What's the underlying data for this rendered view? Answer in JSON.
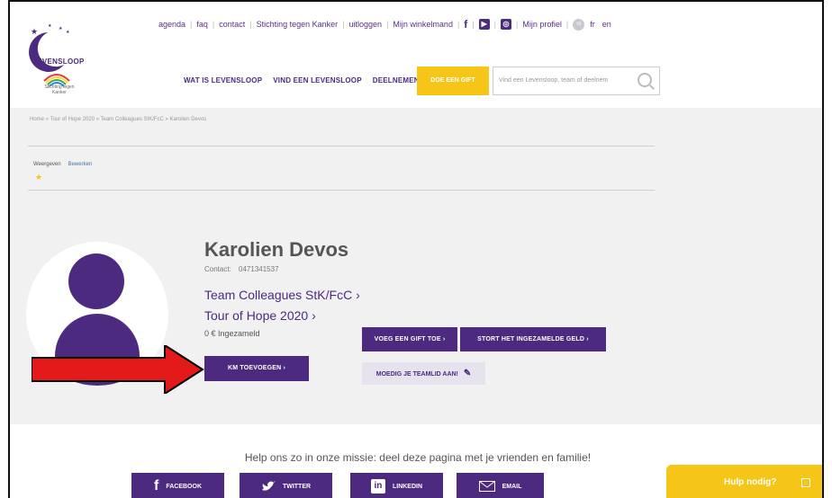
{
  "logo": {
    "brand": "LEVENSLOOP",
    "sub": "Stichting tegen Kanker"
  },
  "toplinks": [
    "agenda",
    "faq",
    "contact",
    "Stichting tegen Kanker",
    "uitloggen",
    "Mijn winkelmand"
  ],
  "profile_link": "Mijn profiel",
  "languages": {
    "nl": "nl",
    "fr": "fr",
    "en": "en"
  },
  "nav": [
    "WAT IS LEVENSLOOP",
    "VIND EEN LEVENSLOOP",
    "DEELNEMEN"
  ],
  "gift_button": "DOE EEN GIFT",
  "search": {
    "placeholder": "Vind een Levensloop, team of deelnem"
  },
  "breadcrumb": "Home » Tour of Hope 2020 » Team Colleagues StK/FcC » Karolien Devos",
  "tabs": {
    "view": "Weergeven",
    "edit": "Bewerken"
  },
  "profile": {
    "name": "Karolien Devos",
    "contact_label": "Contact:",
    "phone": "0471341537",
    "team": "Team Colleagues StK/FcC ›",
    "event": "Tour of Hope 2020 ›",
    "raised": "0 € Ingezameld"
  },
  "buttons": {
    "gift": "VOEG EEN GIFT TOE ›",
    "stort": "STORT HET INGEZAMELDE GELD ›",
    "km": "KM TOEVOEGEN ›",
    "moedig": "MOEDIG JE TEAMLID AAN!"
  },
  "share": {
    "text": "Help ons zo in onze missie: deel deze pagina met je vrienden en familie!",
    "facebook": "FACEBOOK",
    "twitter": "TWITTER",
    "linkedin": "LINKEDIN",
    "email": "EMAIL"
  },
  "help": "Hulp nodig?",
  "colors": {
    "purple": "#4b2a80",
    "yellow": "#f5c518",
    "arrow": "#e41a1a"
  }
}
